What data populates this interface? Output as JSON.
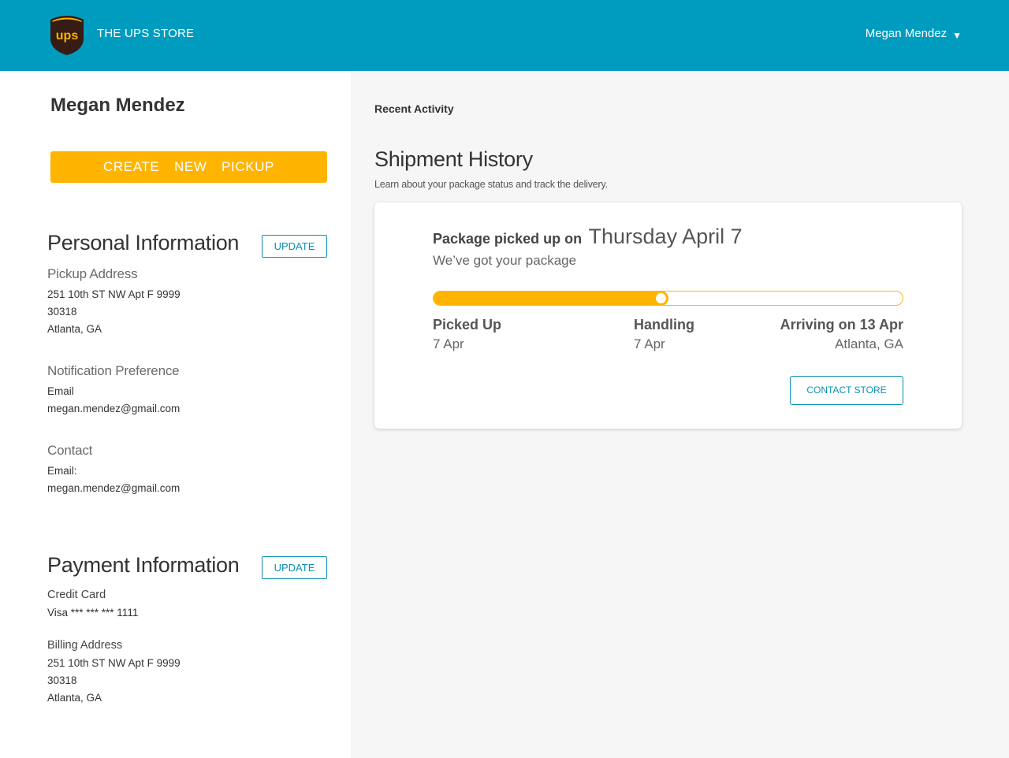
{
  "header": {
    "brand": "THE UPS STORE",
    "user_name": "Megan Mendez",
    "caret": "▼",
    "logo_text": "UPS",
    "colors": {
      "bar": "#009cbf",
      "logo_shield": "#351c15",
      "logo_gold": "#ffb500"
    }
  },
  "profile": {
    "name": "Megan Mendez",
    "create_pickup_label": "CREATE  NEW  PICKUP"
  },
  "personal": {
    "title": "Personal Information",
    "update_label": "UPDATE",
    "pickup_address": {
      "label": "Pickup Address",
      "lines": [
        "251 10th ST NW Apt F 9999",
        "30318",
        "Atlanta, GA"
      ]
    },
    "notification": {
      "label": "Notification Preference",
      "method": "Email",
      "value": "megan.mendez@gmail.com"
    },
    "contact": {
      "label": "Contact",
      "method": "Email:",
      "value": "megan.mendez@gmail.com"
    }
  },
  "payment": {
    "title": "Payment Information",
    "update_label": "UPDATE",
    "card_label": "Credit Card",
    "card_value": "Visa *** *** *** 1111",
    "billing_label": "Billing Address",
    "billing_lines": [
      "251 10th ST NW Apt F 9999",
      "30318",
      "Atlanta, GA"
    ]
  },
  "main": {
    "recent_label": "Recent Activity",
    "title": "Shipment History",
    "subtitle": "Learn about your package status and track the delivery.",
    "shipment": {
      "status_prefix": "Package picked up on",
      "status_date": "Thursday April 7",
      "status_message": "We’ve got your package",
      "progress_fraction": 0.485,
      "steps": [
        {
          "name": "Picked Up",
          "detail": "7 Apr"
        },
        {
          "name": "Handling",
          "detail": "7 Apr"
        },
        {
          "name": "Arriving on 13 Apr",
          "detail": "Atlanta, GA"
        }
      ],
      "contact_label": "CONTACT STORE"
    }
  },
  "accent_colors": {
    "primary": "#ffb500",
    "link": "#0a8fb3"
  }
}
